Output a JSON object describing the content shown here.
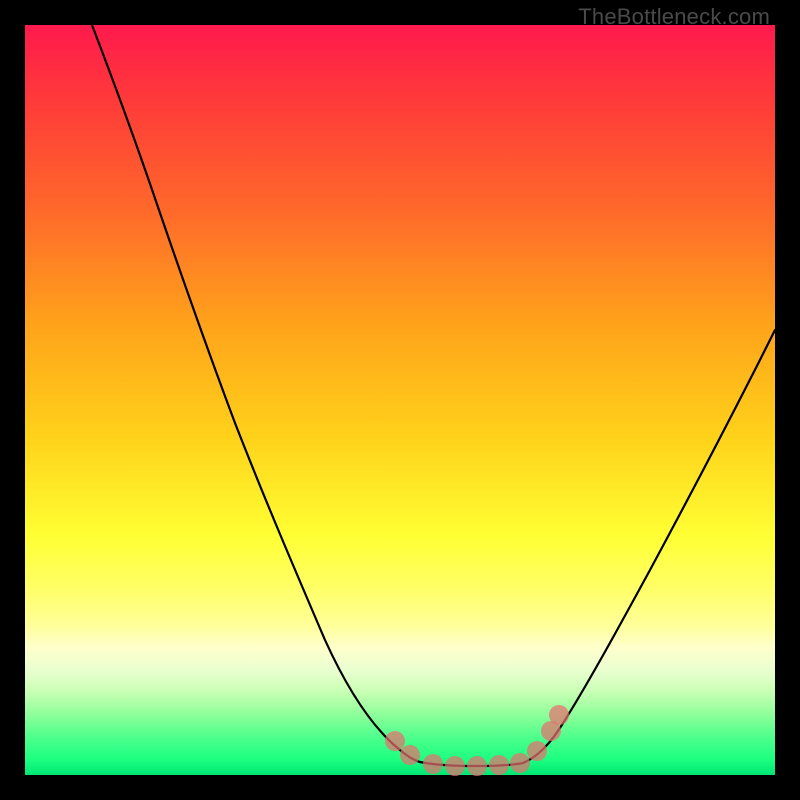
{
  "watermark": "TheBottleneck.com",
  "chart_data": {
    "type": "line",
    "title": "",
    "xlabel": "",
    "ylabel": "",
    "xlim": [
      0,
      100
    ],
    "ylim": [
      0,
      100
    ],
    "grid": false,
    "legend": false,
    "background": "rainbow-vertical-gradient",
    "note": "Axes are unlabeled in the image; values are normalized 0–100 estimates read from pixel positions.",
    "series": [
      {
        "name": "left-branch",
        "x": [
          9,
          12,
          15,
          18,
          22,
          26,
          30,
          34,
          38,
          42,
          45,
          48,
          50,
          52
        ],
        "y": [
          100,
          92,
          84,
          75,
          65,
          55,
          44,
          34,
          24,
          15,
          9,
          5,
          3,
          2
        ]
      },
      {
        "name": "valley-floor",
        "x": [
          52,
          55,
          58,
          60,
          62,
          64,
          66
        ],
        "y": [
          2,
          2,
          2,
          2,
          2,
          2,
          2
        ]
      },
      {
        "name": "right-branch",
        "x": [
          66,
          69,
          72,
          76,
          80,
          85,
          90,
          95,
          100
        ],
        "y": [
          2,
          5,
          10,
          18,
          27,
          37,
          47,
          57,
          66
        ]
      }
    ],
    "markers": {
      "name": "highlight-points",
      "style": "pink-dots",
      "x": [
        49,
        51,
        54,
        57,
        60,
        63,
        66,
        68,
        70,
        71
      ],
      "y": [
        5,
        3,
        2,
        2,
        2,
        2,
        2,
        4,
        7,
        10
      ]
    }
  }
}
